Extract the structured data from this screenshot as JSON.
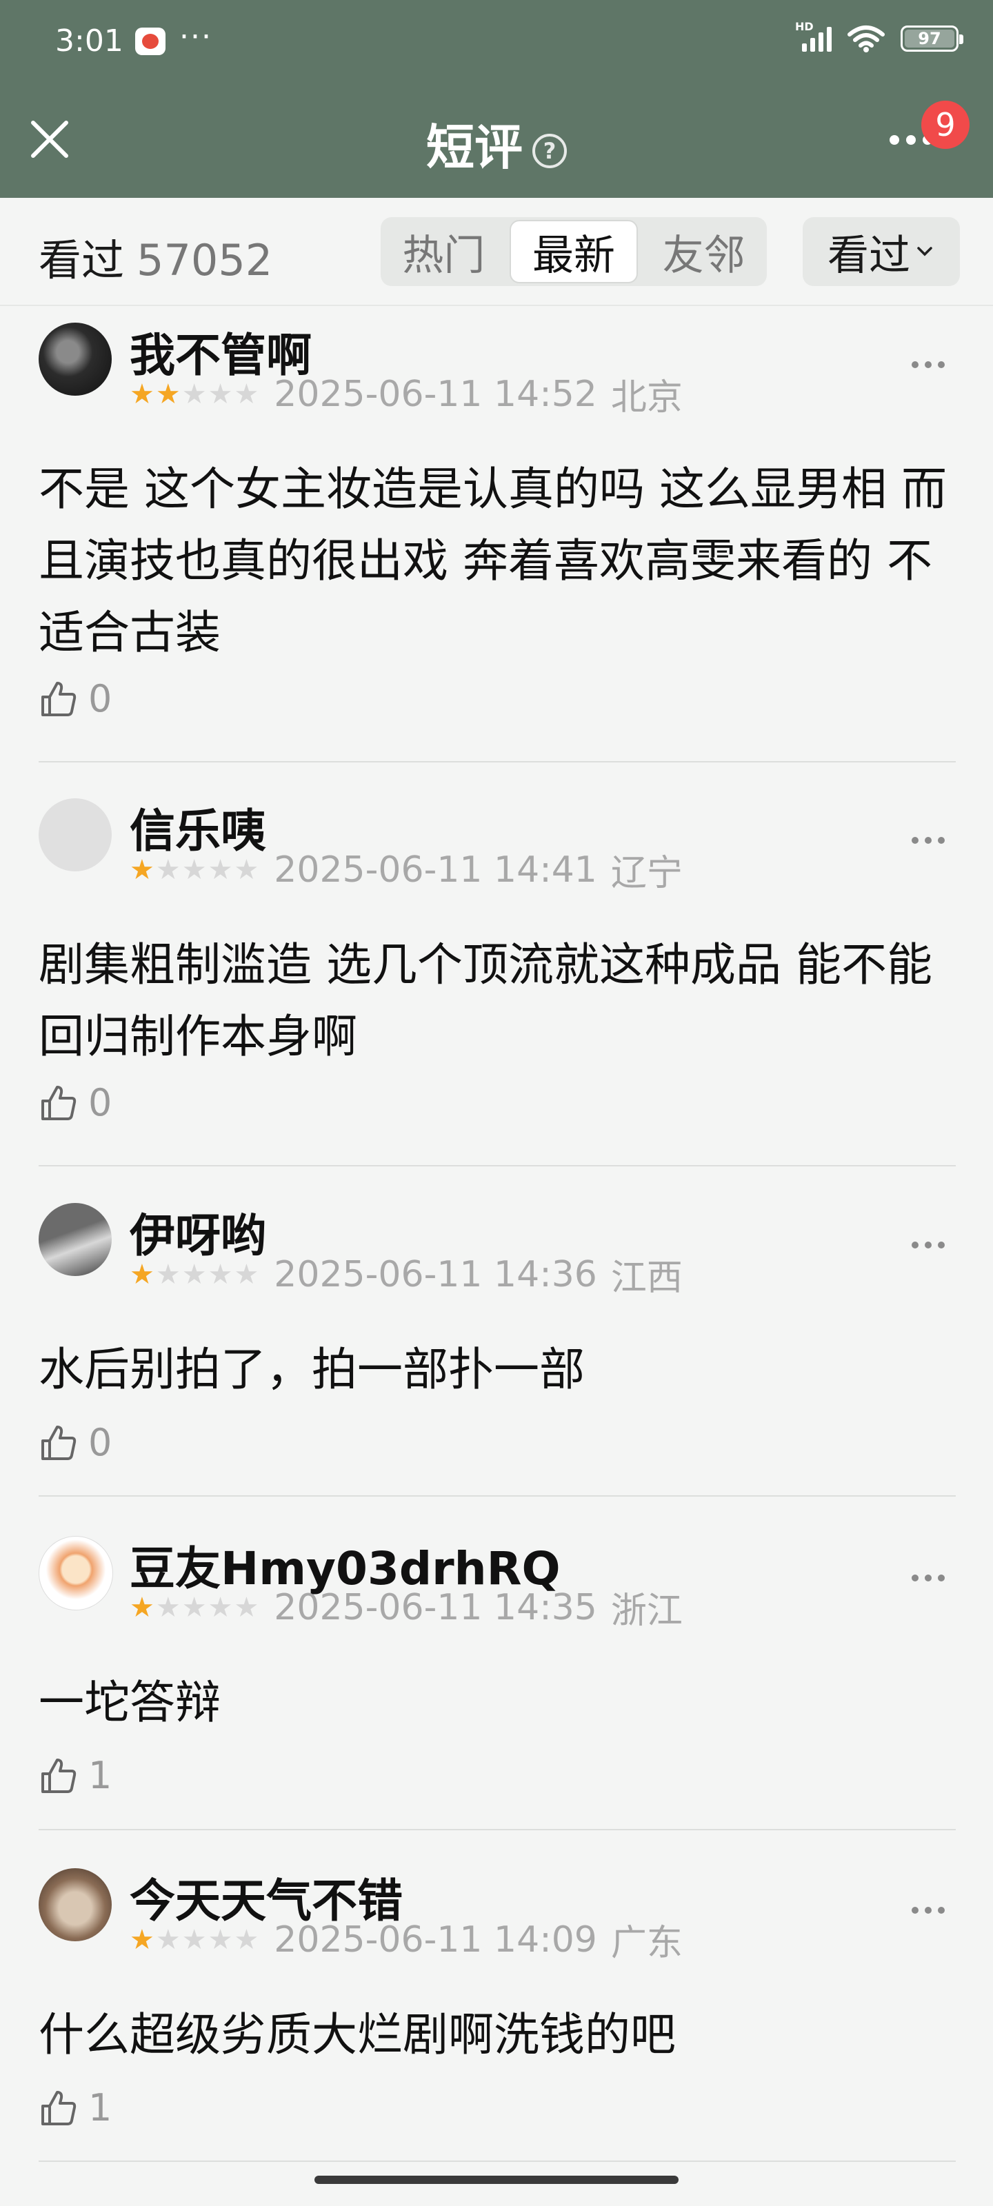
{
  "status": {
    "time": "3:01",
    "dots": "···",
    "battery": "97"
  },
  "header": {
    "title": "短评",
    "help": "?",
    "badge": "9"
  },
  "filter": {
    "watched_label": "看过",
    "watched_count": "57052",
    "tabs": [
      {
        "label": "热门",
        "active": false
      },
      {
        "label": "最新",
        "active": true
      },
      {
        "label": "友邻",
        "active": false
      }
    ],
    "dropdown_label": "看过"
  },
  "reviews": [
    {
      "user": "我不管啊",
      "rating": 2,
      "date": "2025-06-11 14:52",
      "location": "北京",
      "content": "不是 这个女主妆造是认真的吗 这么显男相 而且演技也真的很出戏 奔着喜欢高雯来看的 不适合古装",
      "likes": "0"
    },
    {
      "user": "信乐咦",
      "rating": 1,
      "date": "2025-06-11 14:41",
      "location": "辽宁",
      "content": "剧集粗制滥造 选几个顶流就这种成品 能不能回归制作本身啊",
      "likes": "0"
    },
    {
      "user": "伊呀哟",
      "rating": 1,
      "date": "2025-06-11 14:36",
      "location": "江西",
      "content": "水后别拍了，拍一部扑一部",
      "likes": "0"
    },
    {
      "user": "豆友Hmy03drhRQ",
      "rating": 1,
      "date": "2025-06-11 14:35",
      "location": "浙江",
      "content": "一坨答辩",
      "likes": "1"
    },
    {
      "user": "今天天气不错",
      "rating": 1,
      "date": "2025-06-11 14:09",
      "location": "广东",
      "content": "什么超级劣质大烂剧啊洗钱的吧",
      "likes": "1"
    }
  ]
}
